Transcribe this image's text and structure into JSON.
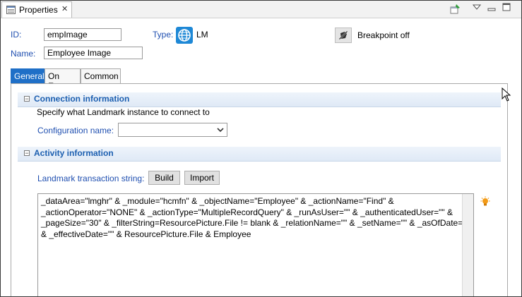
{
  "view": {
    "title": "Properties",
    "close_glyph": "✕"
  },
  "form": {
    "id_label": "ID:",
    "id_value": "empImage",
    "type_label": "Type:",
    "type_value": "LM",
    "name_label": "Name:",
    "name_value": "Employee Image",
    "breakpoint_label": "Breakpoint off"
  },
  "tabs": [
    {
      "label": "General",
      "active": true
    },
    {
      "label": "On Error",
      "active": false
    },
    {
      "label": "Common",
      "active": false
    }
  ],
  "connection": {
    "title": "Connection information",
    "toggle": "−",
    "description": "Specify what Landmark instance to connect to",
    "config_label": "Configuration name:",
    "config_value": ""
  },
  "activity": {
    "title": "Activity information",
    "toggle": "−",
    "transaction_label": "Landmark transaction string:",
    "build_label": "Build",
    "import_label": "Import",
    "transaction_string": "_dataArea=\"lmghr\" & _module=\"hcmfn\" & _objectName=\"Employee\" & _actionName=\"Find\" & _actionOperator=\"NONE\" & _actionType=\"MultipleRecordQuery\" & _runAsUser=\"\" & _authenticatedUser=\"\" & _pageSize=\"30\" & _filterString=ResourcePicture.File != blank & _relationName=\"\" & _setName=\"\" & _asOfDate=\"\" & _effectiveDate=\"\" & ResourcePicture.File & Employee"
  },
  "colors": {
    "accent": "#1f6fc7",
    "section_title": "#1c5fb0",
    "field_label": "#1f4fb0"
  }
}
